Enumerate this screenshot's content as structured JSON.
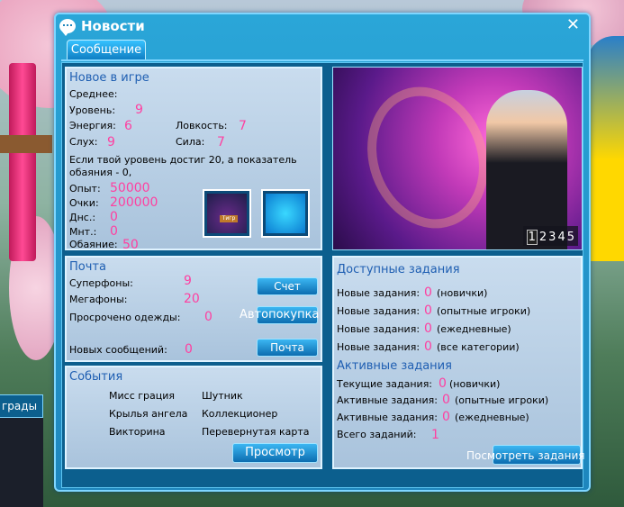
{
  "background": {
    "side_tab_label": "грады"
  },
  "window": {
    "title": "Новости",
    "close_label": "✕",
    "tab_label": "Сообщение"
  },
  "game_news": {
    "title": "Новое в игре",
    "middle_label": "Среднее:",
    "level_label": "Уровень:",
    "level_value": "9",
    "energy_label": "Энергия:",
    "energy_value": "6",
    "agility_label": "Ловкость:",
    "agility_value": "7",
    "hearing_label": "Слух:",
    "hearing_value": "9",
    "strength_label": "Сила:",
    "strength_value": "7",
    "description_line1": "Если твой уровень достиг 20, а показатель",
    "description_line2": "обаяния - 0,",
    "exp_label": "Опыт:",
    "exp_value": "50000",
    "points_label": "Очки:",
    "points_value": "200000",
    "dns_label": "Днс.:",
    "dns_value": "0",
    "mnt_label": "Мнт.:",
    "mnt_value": "0",
    "charm_label": "Обаяние:",
    "charm_value": "50",
    "item1_tag": "Тигр"
  },
  "promo": {
    "pages": [
      "1",
      "2",
      "3",
      "4",
      "5"
    ],
    "active_page": "1"
  },
  "mail": {
    "title": "Почта",
    "superphones_label": "Суперфоны:",
    "superphones_value": "9",
    "megaphones_label": "Мегафоны:",
    "megaphones_value": "20",
    "expired_clothes_label": "Просрочено одежды:",
    "expired_clothes_value": "0",
    "new_messages_label": "Новых сообщений:",
    "new_messages_value": "0",
    "account_button": "Счет",
    "autobuy_button": "Автопокупка",
    "mail_button": "Почта"
  },
  "events": {
    "title": "События",
    "items": [
      "Мисс грация",
      "Шутник",
      "Крылья ангела",
      "Коллекционер",
      "Викторина",
      "Перевернутая карта"
    ],
    "view_button": "Просмотр"
  },
  "tasks": {
    "available_title": "Доступные задания",
    "available": [
      {
        "label": "Новые задания:",
        "value": "0",
        "suffix": "(новички)"
      },
      {
        "label": "Новые задания:",
        "value": "0",
        "suffix": "(опытные игроки)"
      },
      {
        "label": "Новые задания:",
        "value": "0",
        "suffix": "(ежедневные)"
      },
      {
        "label": "Новые задания:",
        "value": "0",
        "suffix": "(все категории)"
      }
    ],
    "active_title": "Активные задания",
    "active": [
      {
        "label": "Текущие задания:",
        "value": "0",
        "suffix": "(новички)"
      },
      {
        "label": "Активные задания:",
        "value": "0",
        "suffix": "(опытные игроки)"
      },
      {
        "label": "Активные задания:",
        "value": "0",
        "suffix": "(ежедневные)"
      }
    ],
    "total_label": "Всего заданий:",
    "total_value": "1",
    "view_tasks_button": "Посмотреть задания"
  }
}
